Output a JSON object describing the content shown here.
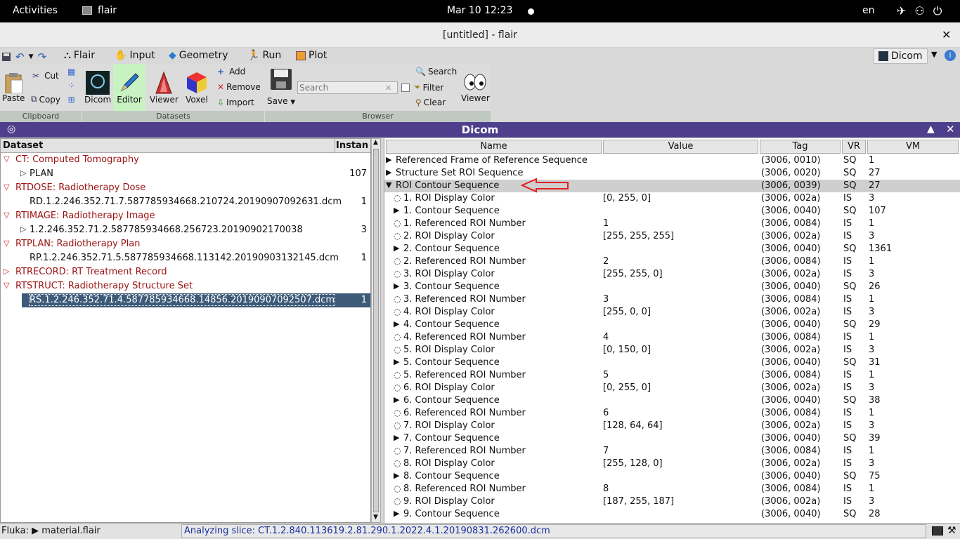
{
  "topbar": {
    "activities": "Activities",
    "app": "flair",
    "clock": "Mar 10  12:23",
    "lang": "en"
  },
  "window": {
    "title": "[untitled] - flair"
  },
  "menu": {
    "flair": "Flair",
    "input": "Input",
    "geometry": "Geometry",
    "run": "Run",
    "plot": "Plot",
    "dicom_tab": "Dicom"
  },
  "ribbon": {
    "paste": "Paste",
    "cut": "Cut",
    "copy": "Copy",
    "dicom": "Dicom",
    "editor": "Editor",
    "viewer": "Viewer",
    "voxel": "Voxel",
    "add": "Add",
    "remove": "Remove",
    "import": "Import",
    "save": "Save",
    "search_placeholder": "Search",
    "search": "Search",
    "filter": "Filter",
    "clear": "Clear",
    "viewer2": "Viewer",
    "groups": {
      "clipboard": "Clipboard",
      "datasets": "Datasets",
      "browser": "Browser"
    }
  },
  "dicom_bar": {
    "title": "Dicom"
  },
  "left": {
    "head_dataset": "Dataset",
    "head_instances": "Instan",
    "rows": [
      {
        "text": "CT: Computed Tomography",
        "count": "",
        "level": 0,
        "expand": "open",
        "red": true
      },
      {
        "text": "PLAN",
        "count": "107",
        "level": 1,
        "expand": "closed",
        "red": false
      },
      {
        "text": "RTDOSE: Radiotherapy Dose",
        "count": "",
        "level": 0,
        "expand": "open",
        "red": true
      },
      {
        "text": "RD.1.2.246.352.71.7.587785934668.210724.20190907092631.dcm",
        "count": "1",
        "level": 1,
        "expand": "none",
        "red": false
      },
      {
        "text": "RTIMAGE: Radiotherapy Image",
        "count": "",
        "level": 0,
        "expand": "open",
        "red": true
      },
      {
        "text": "1.2.246.352.71.2.587785934668.256723.20190902170038",
        "count": "3",
        "level": 1,
        "expand": "closed",
        "red": false
      },
      {
        "text": "RTPLAN: Radiotherapy Plan",
        "count": "",
        "level": 0,
        "expand": "open",
        "red": true
      },
      {
        "text": "RP.1.2.246.352.71.5.587785934668.113142.20190903132145.dcm",
        "count": "1",
        "level": 1,
        "expand": "none",
        "red": false
      },
      {
        "text": "RTRECORD: RT Treatment Record",
        "count": "",
        "level": 0,
        "expand": "closedred",
        "red": true
      },
      {
        "text": "RTSTRUCT: Radiotherapy Structure Set",
        "count": "",
        "level": 0,
        "expand": "open",
        "red": true
      },
      {
        "text": "RS.1.2.246.352.71.4.587785934668.14856.20190907092507.dcm",
        "count": "1",
        "level": 1,
        "expand": "none",
        "red": false,
        "selected": true
      }
    ]
  },
  "right": {
    "headers": {
      "name": "Name",
      "value": "Value",
      "tag": "Tag",
      "vr": "VR",
      "vm": "VM"
    },
    "rows": [
      {
        "icon": "▶",
        "name": "Referenced Frame of Reference Sequence",
        "value": "",
        "tag": "(3006, 0010)",
        "vr": "SQ",
        "vm": "1",
        "indent": 0
      },
      {
        "icon": "▶",
        "name": "Structure Set ROI Sequence",
        "value": "",
        "tag": "(3006, 0020)",
        "vr": "SQ",
        "vm": "27",
        "indent": 0
      },
      {
        "icon": "▼",
        "name": "ROI Contour Sequence",
        "value": "",
        "tag": "(3006, 0039)",
        "vr": "SQ",
        "vm": "27",
        "indent": 0,
        "highlight": true
      },
      {
        "icon": "◌",
        "name": "1. ROI Display Color",
        "value": "[0, 255, 0]",
        "tag": "(3006, 002a)",
        "vr": "IS",
        "vm": "3",
        "indent": 1
      },
      {
        "icon": "▶",
        "name": "1. Contour Sequence",
        "value": "",
        "tag": "(3006, 0040)",
        "vr": "SQ",
        "vm": "107",
        "indent": 1
      },
      {
        "icon": "◌",
        "name": "1. Referenced ROI Number",
        "value": "1",
        "tag": "(3006, 0084)",
        "vr": "IS",
        "vm": "1",
        "indent": 1
      },
      {
        "icon": "◌",
        "name": "2. ROI Display Color",
        "value": "[255, 255, 255]",
        "tag": "(3006, 002a)",
        "vr": "IS",
        "vm": "3",
        "indent": 1
      },
      {
        "icon": "▶",
        "name": "2. Contour Sequence",
        "value": "",
        "tag": "(3006, 0040)",
        "vr": "SQ",
        "vm": "1361",
        "indent": 1
      },
      {
        "icon": "◌",
        "name": "2. Referenced ROI Number",
        "value": "2",
        "tag": "(3006, 0084)",
        "vr": "IS",
        "vm": "1",
        "indent": 1
      },
      {
        "icon": "◌",
        "name": "3. ROI Display Color",
        "value": "[255, 255, 0]",
        "tag": "(3006, 002a)",
        "vr": "IS",
        "vm": "3",
        "indent": 1
      },
      {
        "icon": "▶",
        "name": "3. Contour Sequence",
        "value": "",
        "tag": "(3006, 0040)",
        "vr": "SQ",
        "vm": "26",
        "indent": 1
      },
      {
        "icon": "◌",
        "name": "3. Referenced ROI Number",
        "value": "3",
        "tag": "(3006, 0084)",
        "vr": "IS",
        "vm": "1",
        "indent": 1
      },
      {
        "icon": "◌",
        "name": "4. ROI Display Color",
        "value": "[255, 0, 0]",
        "tag": "(3006, 002a)",
        "vr": "IS",
        "vm": "3",
        "indent": 1
      },
      {
        "icon": "▶",
        "name": "4. Contour Sequence",
        "value": "",
        "tag": "(3006, 0040)",
        "vr": "SQ",
        "vm": "29",
        "indent": 1
      },
      {
        "icon": "◌",
        "name": "4. Referenced ROI Number",
        "value": "4",
        "tag": "(3006, 0084)",
        "vr": "IS",
        "vm": "1",
        "indent": 1
      },
      {
        "icon": "◌",
        "name": "5. ROI Display Color",
        "value": "[0, 150, 0]",
        "tag": "(3006, 002a)",
        "vr": "IS",
        "vm": "3",
        "indent": 1
      },
      {
        "icon": "▶",
        "name": "5. Contour Sequence",
        "value": "",
        "tag": "(3006, 0040)",
        "vr": "SQ",
        "vm": "31",
        "indent": 1
      },
      {
        "icon": "◌",
        "name": "5. Referenced ROI Number",
        "value": "5",
        "tag": "(3006, 0084)",
        "vr": "IS",
        "vm": "1",
        "indent": 1
      },
      {
        "icon": "◌",
        "name": "6. ROI Display Color",
        "value": "[0, 255, 0]",
        "tag": "(3006, 002a)",
        "vr": "IS",
        "vm": "3",
        "indent": 1
      },
      {
        "icon": "▶",
        "name": "6. Contour Sequence",
        "value": "",
        "tag": "(3006, 0040)",
        "vr": "SQ",
        "vm": "38",
        "indent": 1
      },
      {
        "icon": "◌",
        "name": "6. Referenced ROI Number",
        "value": "6",
        "tag": "(3006, 0084)",
        "vr": "IS",
        "vm": "1",
        "indent": 1
      },
      {
        "icon": "◌",
        "name": "7. ROI Display Color",
        "value": "[128, 64, 64]",
        "tag": "(3006, 002a)",
        "vr": "IS",
        "vm": "3",
        "indent": 1
      },
      {
        "icon": "▶",
        "name": "7. Contour Sequence",
        "value": "",
        "tag": "(3006, 0040)",
        "vr": "SQ",
        "vm": "39",
        "indent": 1
      },
      {
        "icon": "◌",
        "name": "7. Referenced ROI Number",
        "value": "7",
        "tag": "(3006, 0084)",
        "vr": "IS",
        "vm": "1",
        "indent": 1
      },
      {
        "icon": "◌",
        "name": "8. ROI Display Color",
        "value": "[255, 128, 0]",
        "tag": "(3006, 002a)",
        "vr": "IS",
        "vm": "3",
        "indent": 1
      },
      {
        "icon": "▶",
        "name": "8. Contour Sequence",
        "value": "",
        "tag": "(3006, 0040)",
        "vr": "SQ",
        "vm": "75",
        "indent": 1
      },
      {
        "icon": "◌",
        "name": "8. Referenced ROI Number",
        "value": "8",
        "tag": "(3006, 0084)",
        "vr": "IS",
        "vm": "1",
        "indent": 1
      },
      {
        "icon": "◌",
        "name": "9. ROI Display Color",
        "value": "[187, 255, 187]",
        "tag": "(3006, 002a)",
        "vr": "IS",
        "vm": "3",
        "indent": 1
      },
      {
        "icon": "▶",
        "name": "9. Contour Sequence",
        "value": "",
        "tag": "(3006, 0040)",
        "vr": "SQ",
        "vm": "28",
        "indent": 1
      }
    ]
  },
  "status": {
    "left": "Fluka: ▶ material.flair",
    "message": "Analyzing slice: CT.1.2.840.113619.2.81.290.1.2022.4.1.20190831.262600.dcm"
  },
  "colors": {
    "dicom_bar": "#4e3f8c",
    "selected_row": "#3d5a78",
    "red_text": "#9b1111",
    "status_text": "#1a2fa0"
  }
}
